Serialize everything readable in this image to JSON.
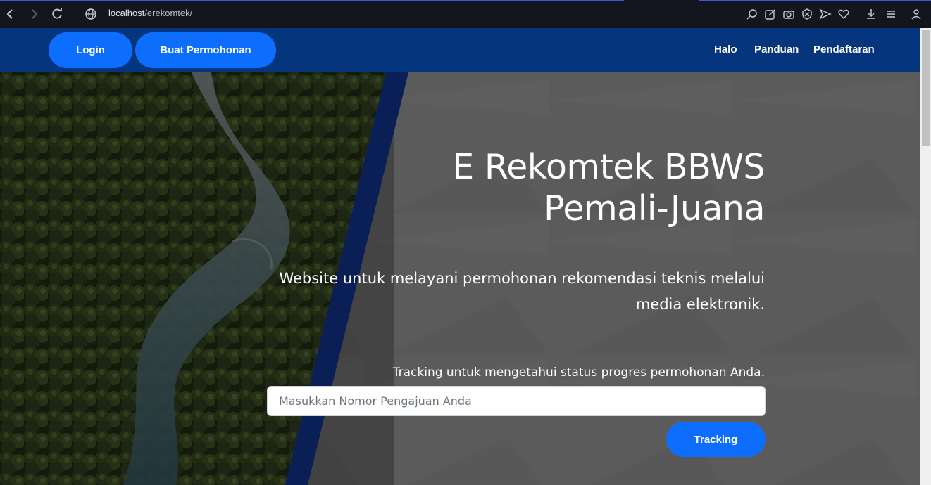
{
  "browser": {
    "url_host": "localhost",
    "url_path": "/erekomtek/",
    "icons": [
      "back-icon",
      "forward-icon",
      "reload-icon",
      "globe-icon",
      "zoom-icon",
      "edit-icon",
      "camera-icon",
      "shield-icon",
      "send-icon",
      "heart-icon",
      "download-icon",
      "menu-icon",
      "profile-icon"
    ]
  },
  "navbar": {
    "login_label": "Login",
    "create_label": "Buat Permohonan",
    "links": [
      "Halo",
      "Panduan",
      "Pendaftaran"
    ]
  },
  "hero": {
    "title_line1": "E Rekomtek BBWS",
    "title_line2": "Pemali-Juana",
    "subtitle_line1": "Website untuk melayani permohonan rekomendasi teknis melalui",
    "subtitle_line2": "media elektronik.",
    "tracking_label": "Tracking untuk mengetahui status progres permohonan Anda.",
    "tracking_placeholder": "Masukkan Nomor Pengajuan Anda",
    "tracking_button": "Tracking"
  },
  "colors": {
    "navbar": "#04357d",
    "button": "#0d6efd",
    "hero_gray": "#5a5a5a",
    "stripe": "#0a1f55"
  }
}
